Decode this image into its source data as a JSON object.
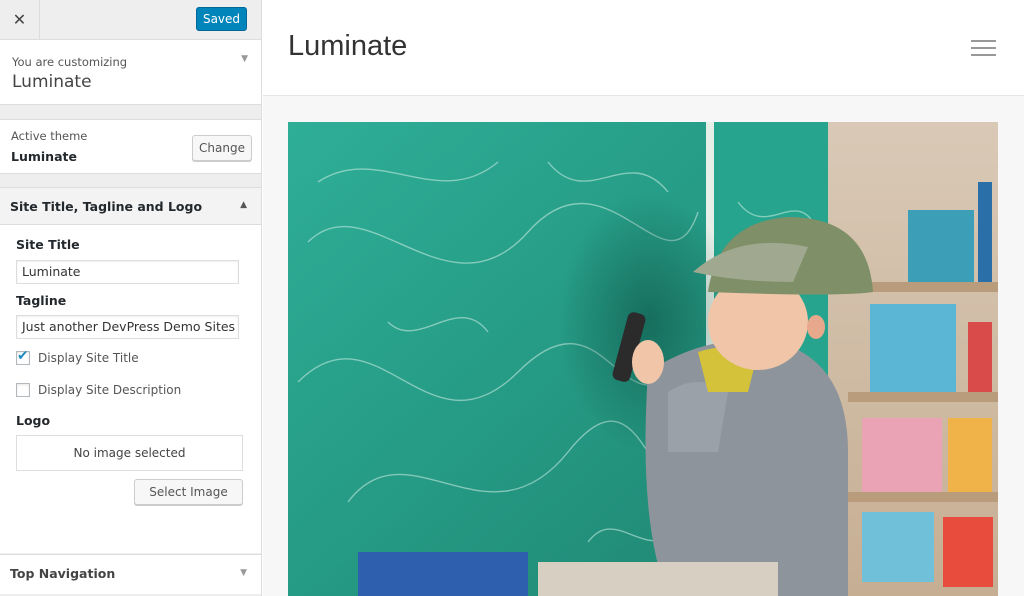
{
  "sidebar": {
    "close_glyph": "✕",
    "save_label": "Saved",
    "customizing_label": "You are customizing",
    "customizing_site": "Luminate",
    "active_theme_label": "Active theme",
    "active_theme_name": "Luminate",
    "change_label": "Change",
    "section": {
      "title": "Site Title, Tagline and Logo",
      "site_title_label": "Site Title",
      "site_title_value": "Luminate",
      "tagline_label": "Tagline",
      "tagline_value": "Just another DevPress Demo Sites site",
      "display_title_label": "Display Site Title",
      "display_title_checked": true,
      "display_desc_label": "Display Site Description",
      "display_desc_checked": false,
      "logo_label": "Logo",
      "no_image_label": "No image selected",
      "select_image_label": "Select Image"
    },
    "next_section": "Top Navigation"
  },
  "preview": {
    "site_title": "Luminate",
    "hero_image": "child-drawing-on-chalkboard-photo"
  },
  "colors": {
    "primary_button": "#0085ba",
    "checkmark": "#1e8cbe",
    "chalkboard": "#2a9b87"
  }
}
